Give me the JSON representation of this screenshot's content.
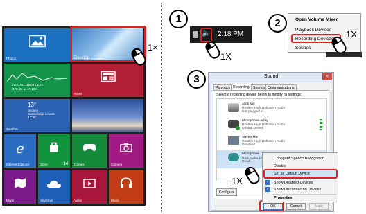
{
  "start_screen": {
    "tiles": [
      {
        "label": "Photos",
        "color": "#1a6fbf"
      },
      {
        "label": "Desktop",
        "color": "#5a8dc4"
      },
      {
        "label": "AEX-IN... 19.08 CEST",
        "sub": "378,15 ▲ +0,13%",
        "label2": "Finance",
        "color": "#14934a"
      },
      {
        "label": "News",
        "color": "#b21e34"
      },
      {
        "label": "13°",
        "sub": "Sydney",
        "sub2": "Gedeeltelijk bewolkt",
        "sub3": "17°/9°",
        "label2": "Weather",
        "color": "#2b62b2"
      },
      {
        "label": "",
        "color": "#3f5ea8"
      },
      {
        "label": "Internet Explorer",
        "color": "#2c6bc2"
      },
      {
        "label": "Store",
        "badge": "14",
        "color": "#12943f"
      },
      {
        "label": "Games",
        "color": "#158a3a"
      },
      {
        "label": "Camera",
        "color": "#a21a84"
      },
      {
        "label": "Maps",
        "color": "#7a1a8a"
      },
      {
        "label": "SkyDrive",
        "color": "#1d5fb6"
      },
      {
        "label": "Video",
        "color": "#a9163b"
      },
      {
        "label": "Music",
        "color": "#c23d16"
      }
    ],
    "click_label": "1×"
  },
  "steps": {
    "step1_number": "1",
    "step2_number": "2",
    "step3_number": "3",
    "clock_time": "2:18 PM",
    "click_label_1": "1X",
    "click_label_2": "1X",
    "click_label_3": "1X"
  },
  "tray_menu": {
    "items": [
      "Open Volume Mixer",
      "Playback Devices",
      "Recording Devices",
      "Sounds"
    ]
  },
  "sound_dialog": {
    "title": "Sound",
    "close": "✕",
    "tabs": [
      "Playback",
      "Recording",
      "Sounds",
      "Communications"
    ],
    "instruction": "Select a recording device below to modify its settings:",
    "devices": [
      {
        "name": "Jack Mic",
        "line2": "Realtek High Definition Audio",
        "line3": "Not plugged in"
      },
      {
        "name": "Microphone Array",
        "line2": "Realtek High Definition Audio",
        "line3": "Default Device"
      },
      {
        "name": "Stereo Mix",
        "line2": "Realtek High Definition Audio",
        "line3": "Disabled"
      },
      {
        "name": "Microphone",
        "line2": "USB Audio Device",
        "line3": "Read..."
      }
    ],
    "configure_button": "Configure",
    "ok_button": "OK",
    "cancel_button": "Cancel",
    "apply_button": "Apply"
  },
  "context_menu": {
    "items": [
      "Configure Speech Recognition",
      "Disable",
      "Set as Default Device",
      "Show Disabled Devices",
      "Show Disconnected Devices",
      "Properties"
    ]
  },
  "colors": {
    "highlight": "#e02020",
    "menu_selected": "#cfe3f7",
    "tab_active": "#ffffff"
  }
}
